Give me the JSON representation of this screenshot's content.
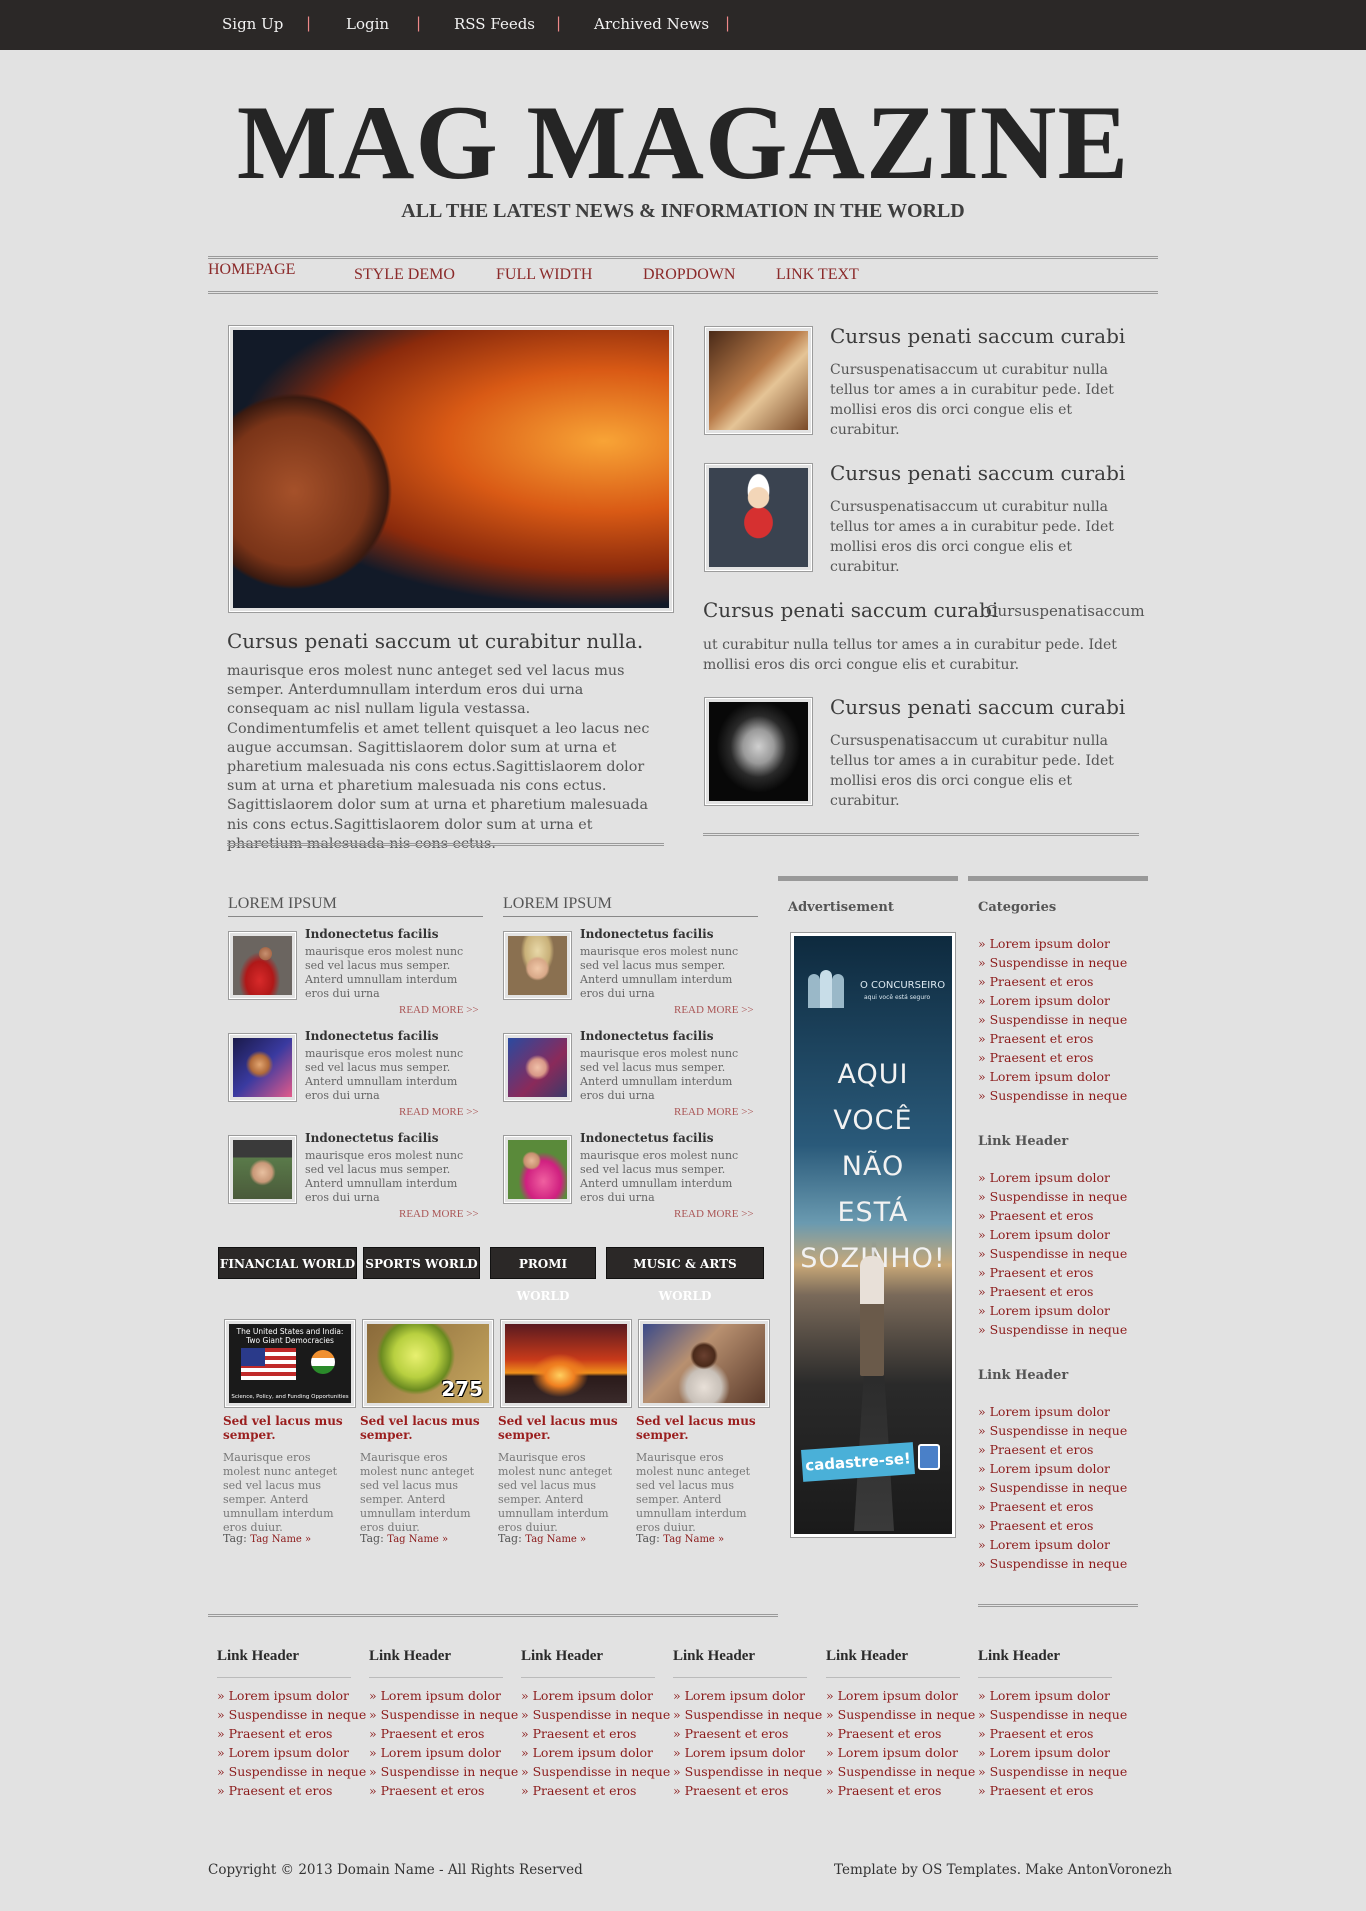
{
  "topnav": [
    "Sign Up",
    "Login",
    "RSS Feeds",
    "Archived News"
  ],
  "site": {
    "title": "MAG MAGAZINE",
    "tagline": "ALL THE LATEST NEWS & INFORMATION IN THE WORLD"
  },
  "menu": [
    "HOMEPAGE",
    "STYLE DEMO",
    "FULL WIDTH",
    "DROPDOWN",
    "LINK TEXT"
  ],
  "feature": {
    "title": "Cursus penati saccum ut curabitur nulla.",
    "body": "maurisque eros molest nunc anteget sed vel lacus mus semper. Anterdumnullam interdum eros dui urna consequam ac nisl nullam ligula vestassa. Condimentumfelis et amet tellent quisquet a leo lacus nec augue accumsan. Sagittislaorem dolor sum at urna et pharetium malesuada nis cons ectus.Sagittislaorem dolor sum at urna et pharetium malesuada nis cons ectus. Sagittislaorem dolor sum at urna et pharetium malesuada nis cons ectus.Sagittislaorem dolor sum at urna et pharetium malesuada nis cons ectus."
  },
  "side_articles": [
    {
      "title": "Cursus penati saccum curabi",
      "body": "Cursuspenatisaccum ut curabitur nulla tellus tor ames a in curabitur pede. Idet mollisi eros dis orci congue elis et curabitur."
    },
    {
      "title": "Cursus penati saccum curabi",
      "body": "Cursuspenatisaccum ut curabitur nulla tellus tor ames a in curabitur pede. Idet mollisi eros dis orci congue elis et curabitur."
    },
    {
      "title": "Cursus penati saccum curabi",
      "inline": "Cursuspenatisaccum",
      "body": "ut curabitur nulla tellus tor ames a in curabitur pede. Idet mollisi eros dis orci congue elis et curabitur."
    },
    {
      "title": "Cursus penati saccum curabi",
      "body": "Cursuspenatisaccum ut curabitur nulla tellus tor ames a in curabitur pede. Idet mollisi eros dis orci congue elis et curabitur."
    }
  ],
  "lorem_sections": [
    {
      "title": "LOREM IPSUM",
      "items": [
        {
          "title": "Indonectetus facilis",
          "body": "maurisque eros molest nunc sed vel lacus mus semper. Anterd umnullam interdum eros dui urna",
          "more": "READ MORE >>"
        },
        {
          "title": "Indonectetus facilis",
          "body": "maurisque eros molest nunc sed vel lacus mus semper. Anterd umnullam interdum eros dui urna",
          "more": "READ MORE >>"
        },
        {
          "title": "Indonectetus facilis",
          "body": "maurisque eros molest nunc sed vel lacus mus semper. Anterd umnullam interdum eros dui urna",
          "more": "READ MORE >>"
        }
      ]
    },
    {
      "title": "LOREM IPSUM",
      "items": [
        {
          "title": "Indonectetus facilis",
          "body": "maurisque eros molest nunc sed vel lacus mus semper. Anterd umnullam interdum eros dui urna",
          "more": "READ MORE >>"
        },
        {
          "title": "Indonectetus facilis",
          "body": "maurisque eros molest nunc sed vel lacus mus semper. Anterd umnullam interdum eros dui urna",
          "more": "READ MORE >>"
        },
        {
          "title": "Indonectetus facilis",
          "body": "maurisque eros molest nunc sed vel lacus mus semper. Anterd umnullam interdum eros dui urna",
          "more": "READ MORE >>"
        }
      ]
    }
  ],
  "categories_tabs": [
    "FINANCIAL WORLD",
    "SPORTS WORLD",
    "PROMI WORLD",
    "MUSIC & ARTS WORLD"
  ],
  "thumbs": [
    {
      "img_text_1": "The United States and India:",
      "img_text_2": "Two Giant Democracies",
      "img_text_3": "Science, Policy, and Funding Opportunities",
      "caption": "Sed vel lacus mus semper.",
      "body": "Maurisque eros molest nunc anteget sed vel lacus mus semper. Anterd umnullam interdum eros duiur.",
      "tag_label": "Tag:",
      "tag": "Tag Name »"
    },
    {
      "img_text": "275",
      "caption": "Sed vel lacus mus semper.",
      "body": "Maurisque eros molest nunc anteget sed vel lacus mus semper. Anterd umnullam interdum eros duiur.",
      "tag_label": "Tag:",
      "tag": "Tag Name »"
    },
    {
      "caption": "Sed vel lacus mus semper.",
      "body": "Maurisque eros molest nunc anteget sed vel lacus mus semper. Anterd umnullam interdum eros duiur.",
      "tag_label": "Tag:",
      "tag": "Tag Name »"
    },
    {
      "caption": "Sed vel lacus mus semper.",
      "body": "Maurisque eros molest nunc anteget sed vel lacus mus semper. Anterd umnullam interdum eros duiur.",
      "tag_label": "Tag:",
      "tag": "Tag Name »"
    }
  ],
  "ad": {
    "header": "Advertisement",
    "brand": "O CONCURSEIRO",
    "brand_sub": "aqui você está seguro",
    "line1": "AQUI VOCÊ",
    "line2": "NÃO",
    "line3": "ESTÁ",
    "line4": "SOZINHO!",
    "cta": "cadastre-se!"
  },
  "sidebar": [
    {
      "title": "Categories",
      "links": [
        "Lorem ipsum dolor",
        "Suspendisse in neque",
        "Praesent et eros",
        "Lorem ipsum dolor",
        "Suspendisse in neque",
        "Praesent et eros",
        "Praesent et eros",
        "Lorem ipsum dolor",
        "Suspendisse in neque"
      ]
    },
    {
      "title": "Link Header",
      "links": [
        "Lorem ipsum dolor",
        "Suspendisse in neque",
        "Praesent et eros",
        "Lorem ipsum dolor",
        "Suspendisse in neque",
        "Praesent et eros",
        "Praesent et eros",
        "Lorem ipsum dolor",
        "Suspendisse in neque"
      ]
    },
    {
      "title": "Link Header",
      "links": [
        "Lorem ipsum dolor",
        "Suspendisse in neque",
        "Praesent et eros",
        "Lorem ipsum dolor",
        "Suspendisse in neque",
        "Praesent et eros",
        "Praesent et eros",
        "Lorem ipsum dolor",
        "Suspendisse in neque"
      ]
    }
  ],
  "footer_cols": [
    {
      "title": "Link Header",
      "links": [
        "Lorem ipsum dolor",
        "Suspendisse in neque",
        "Praesent et eros",
        "Lorem ipsum dolor",
        "Suspendisse in neque",
        "Praesent et eros"
      ]
    },
    {
      "title": "Link Header",
      "links": [
        "Lorem ipsum dolor",
        "Suspendisse in neque",
        "Praesent et eros",
        "Lorem ipsum dolor",
        "Suspendisse in neque",
        "Praesent et eros"
      ]
    },
    {
      "title": "Link Header",
      "links": [
        "Lorem ipsum dolor",
        "Suspendisse in neque",
        "Praesent et eros",
        "Lorem ipsum dolor",
        "Suspendisse in neque",
        "Praesent et eros"
      ]
    },
    {
      "title": "Link Header",
      "links": [
        "Lorem ipsum dolor",
        "Suspendisse in neque",
        "Praesent et eros",
        "Lorem ipsum dolor",
        "Suspendisse in neque",
        "Praesent et eros"
      ]
    },
    {
      "title": "Link Header",
      "links": [
        "Lorem ipsum dolor",
        "Suspendisse in neque",
        "Praesent et eros",
        "Lorem ipsum dolor",
        "Suspendisse in neque",
        "Praesent et eros"
      ]
    },
    {
      "title": "Link Header",
      "links": [
        "Lorem ipsum dolor",
        "Suspendisse in neque",
        "Praesent et eros",
        "Lorem ipsum dolor",
        "Suspendisse in neque",
        "Praesent et eros"
      ]
    }
  ],
  "copyright": "Copyright © 2013 Domain Name - All Rights Reserved",
  "credit": "Template by OS Templates. Make AntonVoronezh",
  "colors": {
    "topbar": "#2b2827",
    "link": "#8b1a1a",
    "background": "#e2e2e2"
  }
}
